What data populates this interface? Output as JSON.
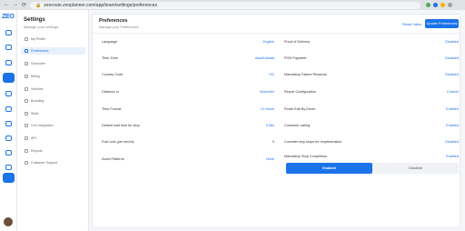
{
  "browser": {
    "url": "zeoroute.zeoplanner.com/app/team/settings/preferences",
    "ext_colors": [
      "#4caf50",
      "#1a73e8",
      "#f4b400",
      "#9e9e9e"
    ]
  },
  "rail": {
    "logo": "ZEO",
    "icons": [
      "home-icon",
      "map-icon",
      "route-icon",
      "add-icon",
      "search-icon",
      "truck-icon",
      "report-icon",
      "chat-icon",
      "people-icon",
      "package-icon",
      "settings-icon"
    ]
  },
  "sidebar": {
    "title": "Settings",
    "subtitle": "Manage your settings",
    "items": [
      {
        "label": "My Profile"
      },
      {
        "label": "Preferences"
      },
      {
        "label": "Geocoder"
      },
      {
        "label": "Billing"
      },
      {
        "label": "Vehicles"
      },
      {
        "label": "Branding"
      },
      {
        "label": "Skills"
      },
      {
        "label": "Crm integration"
      },
      {
        "label": "API"
      },
      {
        "label": "Reports"
      },
      {
        "label": "Customer Support"
      }
    ]
  },
  "main": {
    "title": "Preferences",
    "subtitle": "Manage your Preferences",
    "reset_label": "Reset Value",
    "update_label": "Update Preferences",
    "left": [
      {
        "label": "Language",
        "value": "English"
      },
      {
        "label": "Time Zone",
        "value": "Asia/Kolkata"
      },
      {
        "label": "Country Code",
        "value": "+91"
      },
      {
        "label": "Distance in",
        "value": "Kilometer"
      },
      {
        "label": "Time Format",
        "value": "12 Hours"
      },
      {
        "label": "Default wait time for stop",
        "value": "3 Min"
      },
      {
        "label": "Fuel cost (per km/mi)",
        "value": "0"
      },
      {
        "label": "Avoid Patterns",
        "value": "None"
      }
    ],
    "right": [
      {
        "label": "Proof of Delivery",
        "value": "Disabled"
      },
      {
        "label": "POD Payment",
        "value": "Disabled"
      },
      {
        "label": "Mandatory Failure Reasons",
        "value": "Disabled"
      },
      {
        "label": "Report Configuration",
        "value": "Custom"
      },
      {
        "label": "Route Edit By Driver",
        "value": "Enabled"
      },
      {
        "label": "Customer calling",
        "value": "Enabled"
      },
      {
        "label": "Consider skip stops for reoptimization",
        "value": "Disabled"
      },
      {
        "label": "Mandatory Stop Completion",
        "value": "Enabled"
      }
    ],
    "segment": {
      "on": "Enabled",
      "off": "Disabled"
    }
  }
}
